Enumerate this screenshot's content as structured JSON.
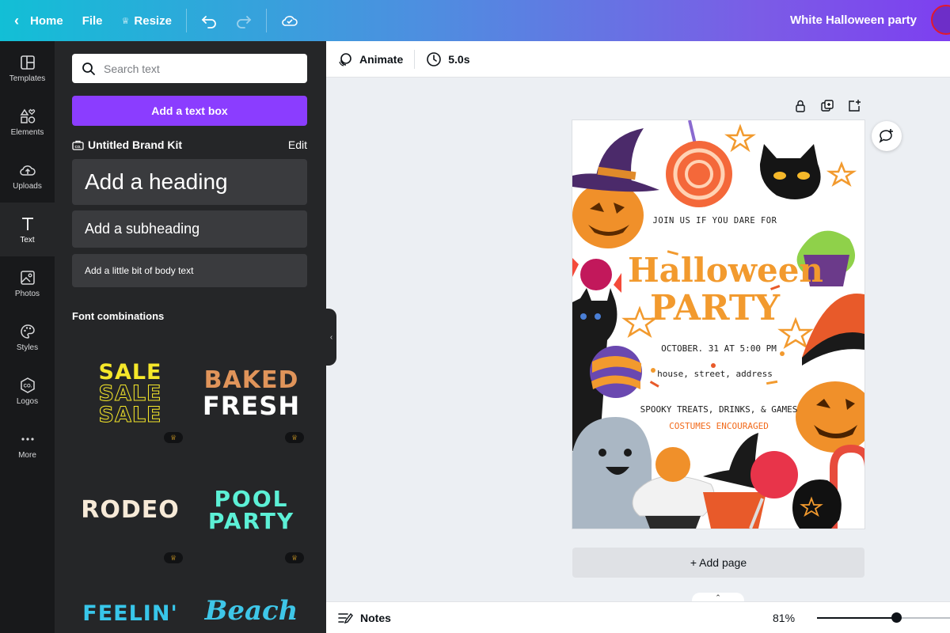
{
  "topbar": {
    "home": "Home",
    "file": "File",
    "resize": "Resize",
    "doc_title": "White Halloween party"
  },
  "rail": {
    "templates": "Templates",
    "elements": "Elements",
    "uploads": "Uploads",
    "text": "Text",
    "photos": "Photos",
    "styles": "Styles",
    "logos": "Logos",
    "more": "More"
  },
  "panel": {
    "search_placeholder": "Search text",
    "add_text_box": "Add a text box",
    "brand_kit": "Untitled Brand Kit",
    "brand_edit": "Edit",
    "heading": "Add a heading",
    "subheading": "Add a subheading",
    "body": "Add a little bit of body text",
    "font_combinations": "Font combinations",
    "combos": {
      "sale": "SALE",
      "baked": "BAKED",
      "fresh": "FRESH",
      "rodeo": "RODEO",
      "pool": "POOL",
      "party": "PARTY",
      "feelin": "FEELIN'",
      "beach": "Beach"
    }
  },
  "editor": {
    "animate": "Animate",
    "duration": "5.0s",
    "add_page": "+ Add page",
    "notes": "Notes",
    "zoom": "81%",
    "zoom_level": 0.81
  },
  "poster": {
    "join": "JOIN US IF YOU DARE FOR",
    "halloween": "Halloween",
    "party": "PARTY",
    "date": "OCTOBER. 31 AT 5:00 PM",
    "address": "house, street, address",
    "treats": "SPOOKY TREATS, DRINKS, & GAMES",
    "costumes": "COSTUMES ENCOURAGED"
  },
  "colors": {
    "accent": "#8b3dff",
    "halloween_orange": "#f29a2e",
    "panel_bg": "#252628",
    "rail_bg": "#18191b"
  }
}
